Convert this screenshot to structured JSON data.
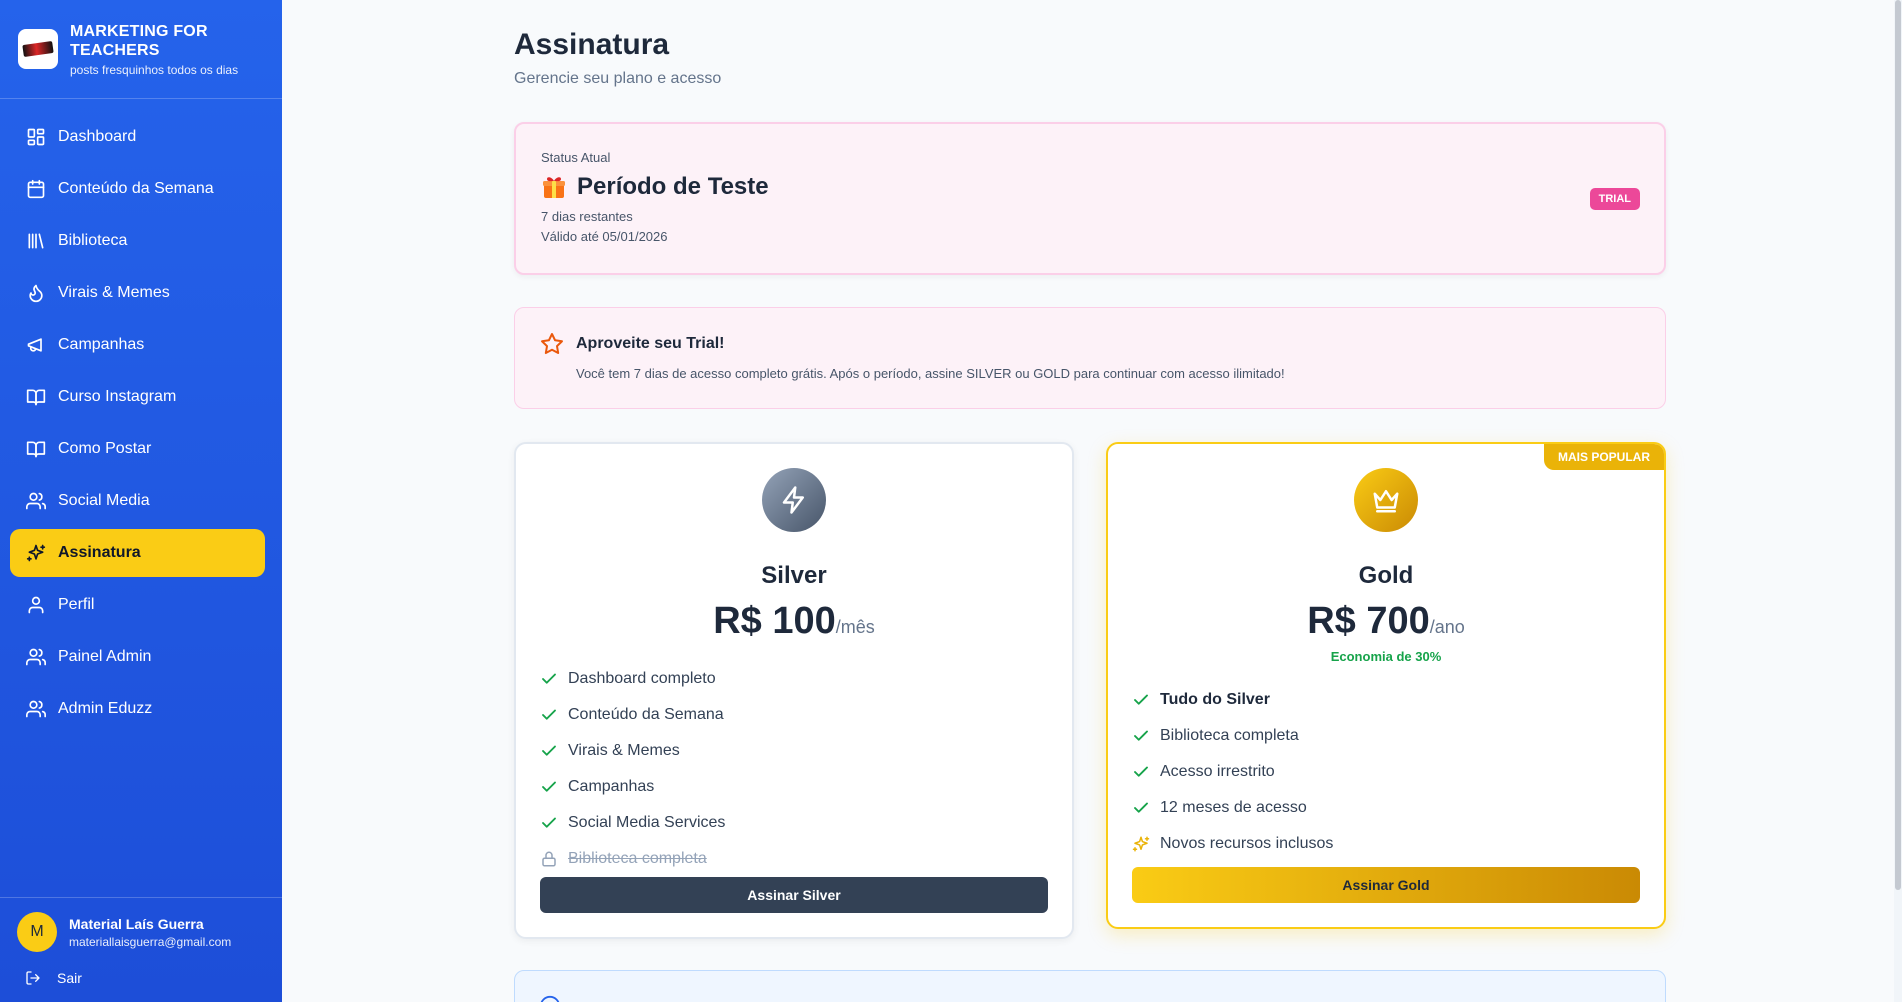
{
  "brand": {
    "title": "MARKETING FOR TEACHERS",
    "subtitle": "posts fresquinhos todos os dias"
  },
  "nav": {
    "items": [
      {
        "label": "Dashboard",
        "icon": "dashboard-icon"
      },
      {
        "label": "Conteúdo da Semana",
        "icon": "calendar-icon"
      },
      {
        "label": "Biblioteca",
        "icon": "library-icon"
      },
      {
        "label": "Virais & Memes",
        "icon": "flame-icon"
      },
      {
        "label": "Campanhas",
        "icon": "megaphone-icon"
      },
      {
        "label": "Curso Instagram",
        "icon": "book-icon"
      },
      {
        "label": "Como Postar",
        "icon": "book-icon"
      },
      {
        "label": "Social Media",
        "icon": "users-icon"
      },
      {
        "label": "Assinatura",
        "icon": "sparkles-icon",
        "active": true
      },
      {
        "label": "Perfil",
        "icon": "user-icon"
      },
      {
        "label": "Painel Admin",
        "icon": "users-icon"
      },
      {
        "label": "Admin Eduzz",
        "icon": "users-icon"
      }
    ]
  },
  "user": {
    "initial": "M",
    "name": "Material Laís Guerra",
    "email": "materiallaisguerra@gmail.com",
    "logout_label": "Sair"
  },
  "page": {
    "title": "Assinatura",
    "subtitle": "Gerencie seu plano e acesso"
  },
  "status": {
    "label": "Status Atual",
    "title": "Período de Teste",
    "days_left": "7 dias restantes",
    "valid_until": "Válido até 05/01/2026",
    "badge": "TRIAL"
  },
  "trial_info": {
    "title": "Aproveite seu Trial!",
    "text": "Você tem 7 dias de acesso completo grátis. Após o período, assine SILVER ou GOLD para continuar com acesso ilimitado!"
  },
  "plans": {
    "silver": {
      "name": "Silver",
      "price": "R$ 100",
      "period": "/mês",
      "features": [
        {
          "label": "Dashboard completo",
          "icon": "check-icon"
        },
        {
          "label": "Conteúdo da Semana",
          "icon": "check-icon"
        },
        {
          "label": "Virais & Memes",
          "icon": "check-icon"
        },
        {
          "label": "Campanhas",
          "icon": "check-icon"
        },
        {
          "label": "Social Media Services",
          "icon": "check-icon"
        },
        {
          "label": "Biblioteca completa",
          "icon": "lock-icon",
          "locked": true
        }
      ],
      "button": "Assinar Silver"
    },
    "gold": {
      "badge": "MAIS POPULAR",
      "name": "Gold",
      "price": "R$ 700",
      "period": "/ano",
      "economy": "Economia de 30%",
      "features": [
        {
          "label": "Tudo do Silver",
          "icon": "check-icon",
          "bold": true
        },
        {
          "label": "Biblioteca completa",
          "icon": "check-icon"
        },
        {
          "label": "Acesso irrestrito",
          "icon": "check-icon"
        },
        {
          "label": "12 meses de acesso",
          "icon": "check-icon"
        },
        {
          "label": "Novos recursos inclusos",
          "icon": "sparkles-icon"
        }
      ],
      "button": "Assinar Gold"
    }
  },
  "colors": {
    "sidebar": "#2563eb",
    "active": "#facc15",
    "trial": "#ec4899",
    "gold": "#eab308",
    "success": "#16a34a"
  }
}
